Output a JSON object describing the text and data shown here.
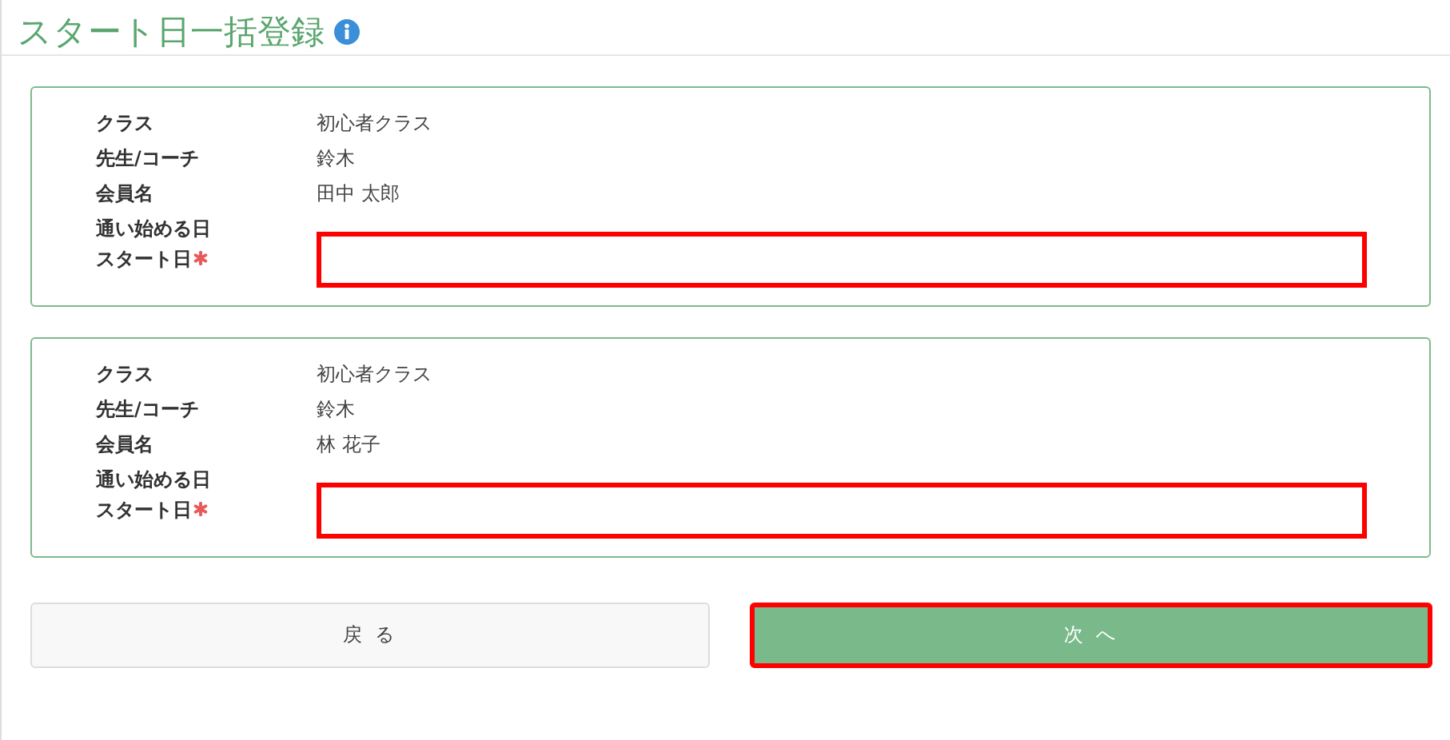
{
  "title": "スタート日一括登録",
  "entries": [
    {
      "rows": [
        {
          "label": "クラス",
          "value": "初心者クラス"
        },
        {
          "label": "先生/コーチ",
          "value": "鈴木"
        },
        {
          "label": "会員名",
          "value": "田中 太郎"
        },
        {
          "label": "通い始める日"
        }
      ],
      "field": {
        "label": "スタート日",
        "required": true
      }
    },
    {
      "rows": [
        {
          "label": "クラス",
          "value": "初心者クラス"
        },
        {
          "label": "先生/コーチ",
          "value": "鈴木"
        },
        {
          "label": "会員名",
          "value": "林 花子"
        },
        {
          "label": "通い始める日"
        }
      ],
      "field": {
        "label": "スタート日",
        "required": true
      }
    }
  ],
  "buttons": [
    {
      "label": "戻 る",
      "kind": "secondary",
      "highlighted": false
    },
    {
      "label": "次 へ",
      "kind": "primary",
      "highlighted": true
    }
  ]
}
